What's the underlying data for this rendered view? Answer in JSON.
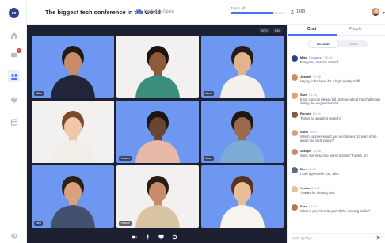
{
  "header": {
    "logo_text": "co",
    "title": "The biggest tech conference in the world",
    "host_text": "Hosted by Opera",
    "time_label": "Time Left",
    "time_progress": 0.78,
    "viewers": "1483"
  },
  "sidebar": {
    "notification_count": "1"
  },
  "stage": {
    "tool_a": "SFO",
    "tool_b": "DM",
    "tiles": [
      {
        "name": "Mike",
        "bg": "blue"
      },
      {
        "name": "",
        "bg": "white"
      },
      {
        "name": "Jane",
        "bg": "blue"
      },
      {
        "name": "",
        "bg": "white"
      },
      {
        "name": "Yesica",
        "bg": "blue"
      },
      {
        "name": "Juan",
        "bg": "blue"
      },
      {
        "name": "Ben",
        "bg": "blue"
      },
      {
        "name": "Yesica",
        "bg": "white"
      },
      {
        "name": "",
        "bg": "blue"
      }
    ]
  },
  "panel": {
    "tabs": [
      "Chat",
      "People"
    ],
    "segments": [
      "Session",
      "Event"
    ],
    "messages": [
      {
        "name": "Mike",
        "role": "Organizer",
        "time": "10:45",
        "text": "Everyone, session started"
      },
      {
        "name": "Joseph",
        "role": "",
        "time": "10:46",
        "text": "Happy to be here, it's a high quality stuff!"
      },
      {
        "name": "Sara",
        "role": "",
        "time": "10:46",
        "text": "Eliot, can you please tell us more about the challenges during the engine launch?"
      },
      {
        "name": "Ronnie",
        "role": "",
        "time": "10:46",
        "text": "This is an amazing speech!"
      },
      {
        "name": "Sofia",
        "role": "",
        "time": "10:47",
        "text": "Which sources would you recommend to learn more about this technology?"
      },
      {
        "name": "Joseph",
        "role": "",
        "time": "10:48",
        "text": "Wow, this is such a useful lecture! Thanks, bro"
      },
      {
        "name": "Ben",
        "role": "",
        "time": "10:48",
        "text": "I fully agree with you, Eliot"
      },
      {
        "name": "Yesica",
        "role": "",
        "time": "10:49",
        "text": "Thanks for sharing this!"
      },
      {
        "name": "Sara",
        "role": "",
        "time": "10:49",
        "text": "What is your favorite part of the meeting so far?"
      }
    ],
    "input_placeholder": "Start typing..."
  },
  "colors": {
    "accent": "#4f6ef7",
    "stage_bg": "#1c2030",
    "tile_blue": "#6d97f0"
  }
}
